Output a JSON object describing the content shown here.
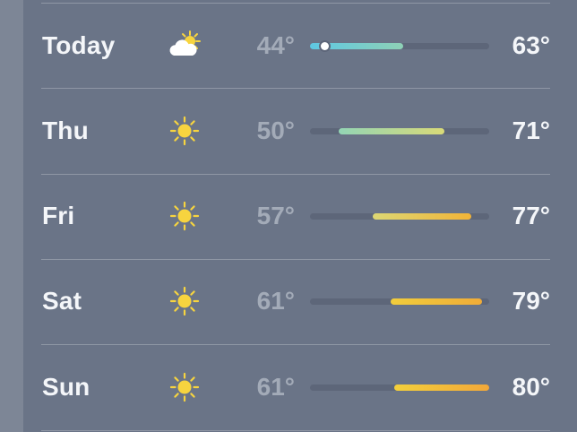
{
  "forecast": [
    {
      "day": "Today",
      "icon": "partly-cloudy-icon",
      "low": "44°",
      "high": "63°",
      "range_start": 0.0,
      "range_end": 0.52,
      "current_marker": 0.08,
      "colors": [
        "#5ec8e3",
        "#8ed1b6"
      ]
    },
    {
      "day": "Thu",
      "icon": "sun-icon",
      "low": "50°",
      "high": "71°",
      "range_start": 0.16,
      "range_end": 0.75,
      "colors": [
        "#93d5b5",
        "#d9da78"
      ]
    },
    {
      "day": "Fri",
      "icon": "sun-icon",
      "low": "57°",
      "high": "77°",
      "range_start": 0.35,
      "range_end": 0.9,
      "colors": [
        "#dcd774",
        "#f2b437"
      ]
    },
    {
      "day": "Sat",
      "icon": "sun-icon",
      "low": "61°",
      "high": "79°",
      "range_start": 0.45,
      "range_end": 0.96,
      "colors": [
        "#f1cd3c",
        "#f0ac38"
      ]
    },
    {
      "day": "Sun",
      "icon": "sun-icon",
      "low": "61°",
      "high": "80°",
      "range_start": 0.47,
      "range_end": 1.0,
      "colors": [
        "#f3cf3b",
        "#f2a83a"
      ]
    }
  ],
  "colors": {
    "card_bg": "#6a7487",
    "sun": "#f7d43f"
  }
}
